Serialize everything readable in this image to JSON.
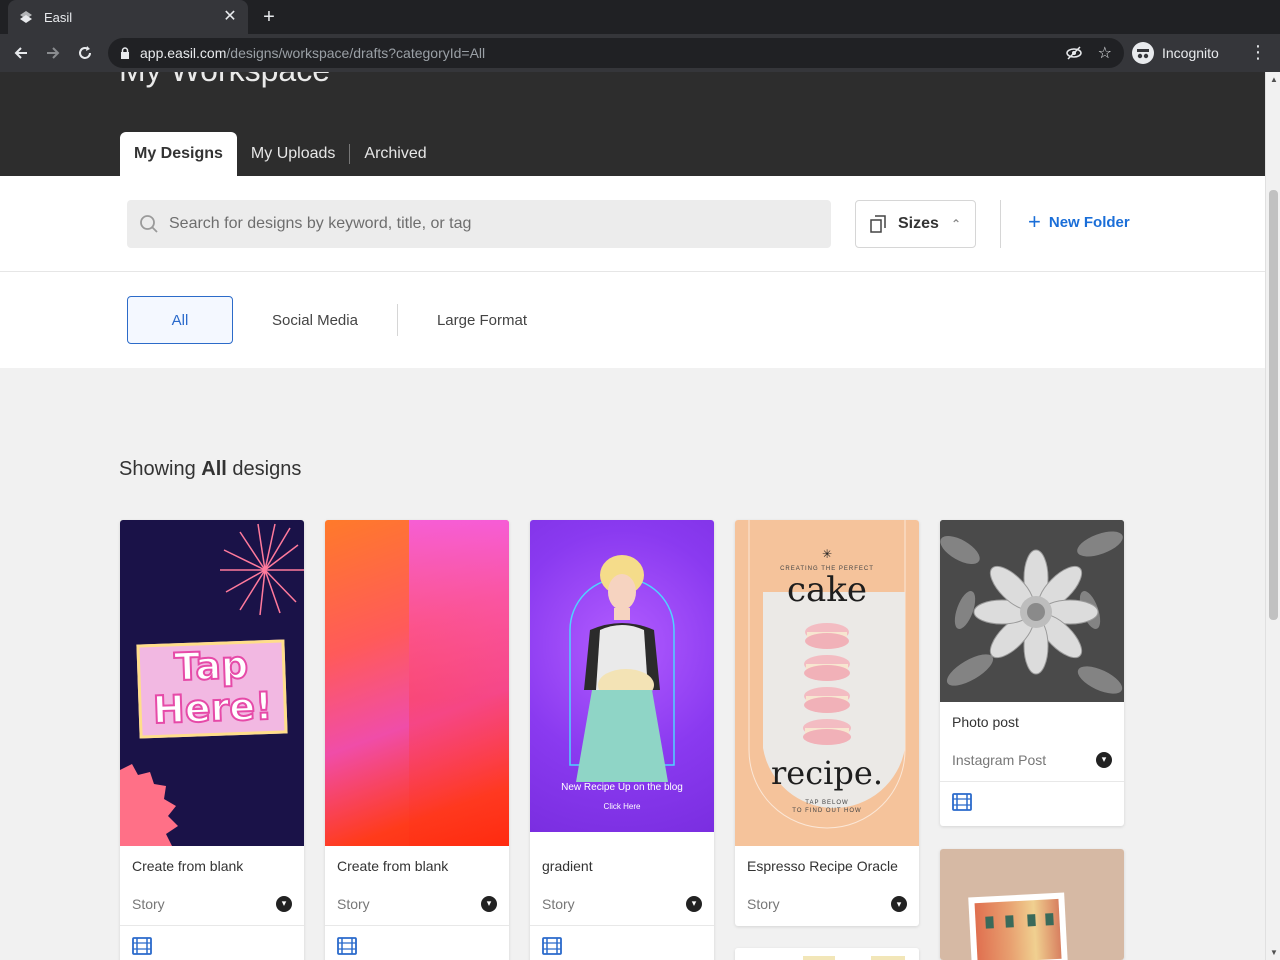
{
  "browser": {
    "tab_title": "Easil",
    "url_host": "app.easil.com",
    "url_path": "/designs/workspace/drafts?categoryId=All",
    "incognito_label": "Incognito"
  },
  "workspace": {
    "title": "My Workspace",
    "tabs": [
      "My Designs",
      "My Uploads",
      "Archived"
    ]
  },
  "toolbar": {
    "search_placeholder": "Search for designs by keyword, title, or tag",
    "sizes_label": "Sizes",
    "new_folder_label": "New Folder"
  },
  "categories": [
    "All",
    "Social Media",
    "Large Format"
  ],
  "showing": {
    "prefix": "Showing",
    "category": "All",
    "suffix": "designs"
  },
  "designs": [
    {
      "name": "Create from blank",
      "type": "Story",
      "art": {
        "line1": "Tap",
        "line2": "Here!"
      }
    },
    {
      "name": "Create from blank",
      "type": "Story"
    },
    {
      "name": "gradient",
      "type": "Story",
      "art": {
        "caption": "New Recipe Up on the blog",
        "cta": "Click Here"
      }
    },
    {
      "name": "Espresso Recipe Oracle",
      "type": "Story",
      "art": {
        "top": "CREATING THE PERFECT",
        "word1": "cake",
        "word2": "recipe.",
        "bottom1": "TAP BELOW",
        "bottom2": "TO FIND OUT HOW"
      }
    },
    {
      "name": "Photo post",
      "type": "Instagram Post"
    }
  ]
}
